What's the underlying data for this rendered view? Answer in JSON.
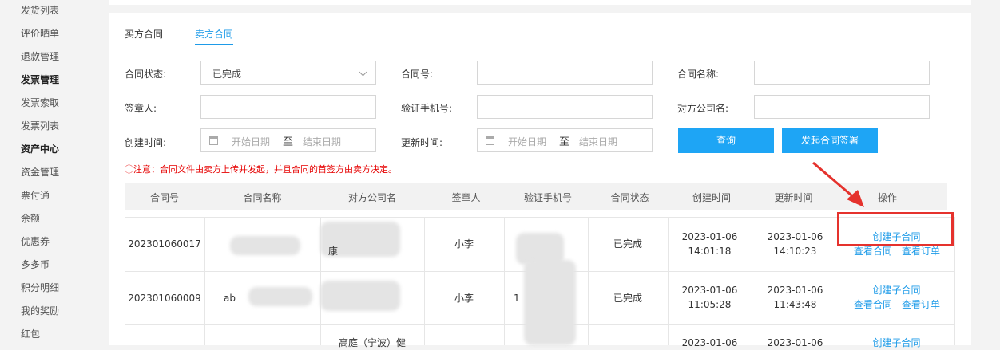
{
  "sidebar": {
    "items": [
      {
        "label": "发货列表",
        "bold": false
      },
      {
        "label": "评价晒单",
        "bold": false
      },
      {
        "label": "退款管理",
        "bold": false
      },
      {
        "label": "发票管理",
        "bold": true
      },
      {
        "label": "发票索取",
        "bold": false
      },
      {
        "label": "发票列表",
        "bold": false
      },
      {
        "label": "资产中心",
        "bold": true
      },
      {
        "label": "资金管理",
        "bold": false
      },
      {
        "label": "票付通",
        "bold": false
      },
      {
        "label": "余额",
        "bold": false
      },
      {
        "label": "优惠券",
        "bold": false
      },
      {
        "label": "多多币",
        "bold": false
      },
      {
        "label": "积分明细",
        "bold": false
      },
      {
        "label": "我的奖励",
        "bold": false
      },
      {
        "label": "红包",
        "bold": false
      }
    ]
  },
  "tabs": {
    "buyer": "买方合同",
    "seller": "卖方合同",
    "active": "seller"
  },
  "filters": {
    "status_label": "合同状态:",
    "status_value": "已完成",
    "contract_no_label": "合同号:",
    "contract_name_label": "合同名称:",
    "signer_label": "签章人:",
    "phone_label": "验证手机号:",
    "company_label": "对方公司名:",
    "created_label": "创建时间:",
    "updated_label": "更新时间:",
    "start_placeholder": "开始日期",
    "end_placeholder": "结束日期",
    "range_sep": "至",
    "query_button": "查询",
    "initiate_button": "发起合同签署"
  },
  "notice": "ⓘ注意：合同文件由卖方上传并发起，并且合同的首签方由卖方决定。",
  "table": {
    "headers": [
      "合同号",
      "合同名称",
      "对方公司名",
      "签章人",
      "验证手机号",
      "合同状态",
      "创建时间",
      "更新时间",
      "操作"
    ],
    "rows": [
      {
        "contract_no": "202301060017",
        "name": "",
        "company": "康",
        "signer": "小李",
        "phone": "",
        "status": "已完成",
        "created_date": "2023-01-06",
        "created_time": "14:01:18",
        "updated_date": "2023-01-06",
        "updated_time": "14:10:23"
      },
      {
        "contract_no": "202301060009",
        "name": "ab",
        "company": "",
        "signer": "小李",
        "phone": "1",
        "status": "已完成",
        "created_date": "2023-01-06",
        "created_time": "11:05:28",
        "updated_date": "2023-01-06",
        "updated_time": "11:43:48"
      },
      {
        "contract_no": "",
        "name": "",
        "company": "高庭（宁波）健",
        "signer": "",
        "phone": "",
        "status": "",
        "created_date": "2023-01-06",
        "created_time": "",
        "updated_date": "2023-01-06",
        "updated_time": ""
      }
    ],
    "actions": {
      "create_sub": "创建子合同",
      "view_contract": "查看合同",
      "view_order": "查看订单"
    }
  },
  "colors": {
    "accent": "#1e9be8",
    "button": "#1ea5f5",
    "warning": "#e60000",
    "highlight": "#e5322d"
  }
}
